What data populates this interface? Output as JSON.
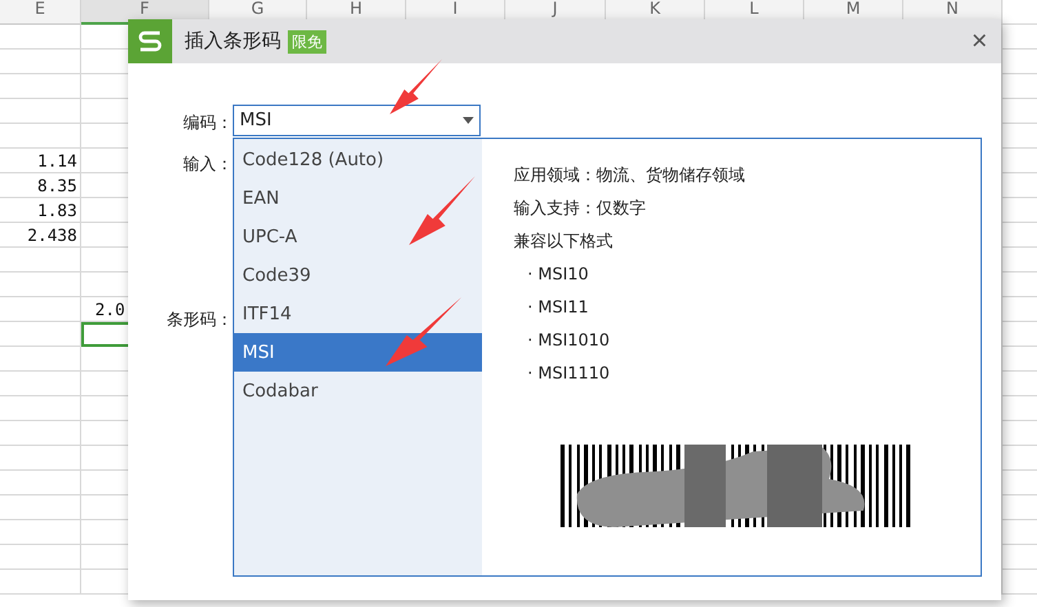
{
  "sheet": {
    "columns": [
      "E",
      "F",
      "G",
      "H",
      "I",
      "J",
      "K",
      "L",
      "M",
      "N"
    ],
    "column_e_values": [
      "1.14",
      "8.35",
      "1.83",
      "2.438"
    ],
    "column_f_value": "2.0"
  },
  "dialog": {
    "title": "插入条形码",
    "badge": "限免",
    "close": "×",
    "encoding_label": "编码：",
    "encoding_value": "MSI",
    "input_label": "输入：",
    "barcode_label": "条形码：",
    "options": [
      {
        "label": "Code128 (Auto)",
        "selected": false
      },
      {
        "label": "EAN",
        "selected": false
      },
      {
        "label": "UPC-A",
        "selected": false
      },
      {
        "label": "Code39",
        "selected": false
      },
      {
        "label": "ITF14",
        "selected": false
      },
      {
        "label": "MSI",
        "selected": true
      },
      {
        "label": "Codabar",
        "selected": false
      }
    ],
    "info": [
      "应用领域：物流、货物储存领域",
      "输入支持：仅数字",
      "兼容以下格式"
    ],
    "formats": [
      "· MSI10",
      "· MSI11",
      "· MSI1010",
      "· MSI1110"
    ]
  }
}
